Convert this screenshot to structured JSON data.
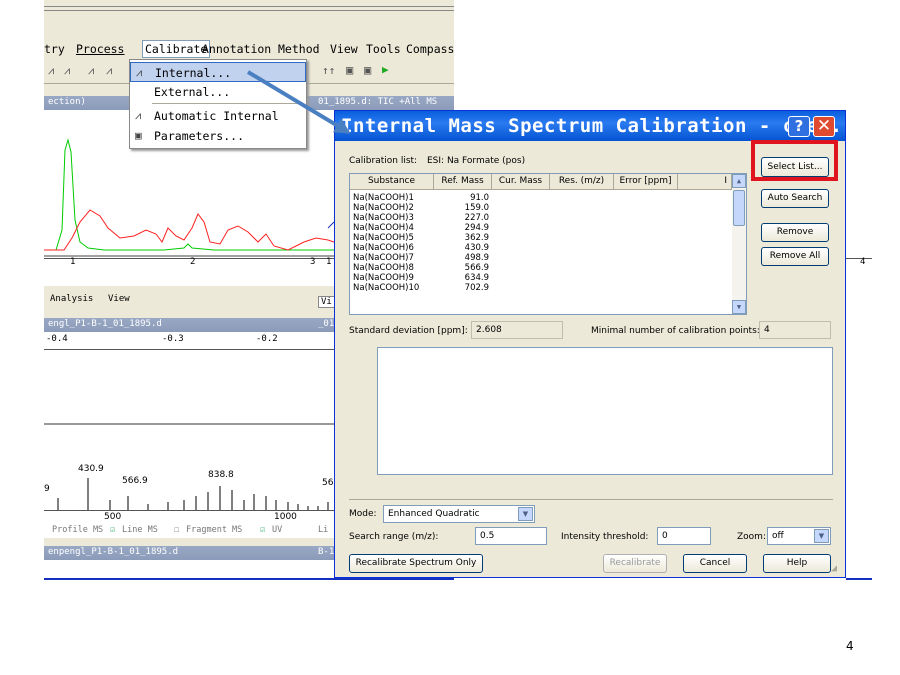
{
  "menubar": {
    "items": [
      "try",
      "Process",
      "Calibrate",
      "Annotation",
      "Method",
      "View",
      "Tools",
      "Compass"
    ],
    "active": "Calibrate"
  },
  "calibrate_menu": {
    "items": [
      {
        "label": "Internal...",
        "icon": "internal-calib-icon",
        "highlighted": true
      },
      {
        "label": "External...",
        "icon": "",
        "highlighted": false
      },
      {
        "label": "Automatic Internal",
        "icon": "auto-internal-icon",
        "highlighted": false
      },
      {
        "label": "Parameters...",
        "icon": "parameters-icon",
        "highlighted": false
      }
    ]
  },
  "background_app": {
    "chrom_title_left": "ection)",
    "chrom_title_right": "01_1895.d: TIC +All MS",
    "chrom_ticks": [
      "1",
      "2",
      "3",
      "1",
      "4"
    ],
    "tabs": [
      "Analysis",
      "View",
      "Vi"
    ],
    "spectrum_title": "engl_P1-B-1_01_1895.d",
    "spectrum_title_right": "_01",
    "spectrum_top_ticks": [
      "-0.4",
      "-0.3",
      "-0.2"
    ],
    "peak_labels": [
      "430.9",
      "566.9",
      "838.8",
      "9",
      "56"
    ],
    "spectrum_bottom_ticks": [
      "500",
      "1000"
    ],
    "spectrum_options": [
      "Profile MS",
      "Line MS",
      "Fragment MS",
      "UV",
      "Li"
    ],
    "spectrum2_title": "enpengl_P1-B-1_01_1895.d",
    "spectrum2_title_right": "B-1"
  },
  "dialog": {
    "title": "Internal Mass Spectrum Calibration - che...",
    "calibration_list_label": "Calibration list:",
    "calibration_list_value": "ESI: Na Formate (pos)",
    "columns": [
      "Substance",
      "Ref. Mass",
      "Cur. Mass",
      "Res. (m/z)",
      "Error [ppm]",
      "I"
    ],
    "rows": [
      {
        "substance": "Na(NaCOOH)1",
        "ref_mass": "91.0"
      },
      {
        "substance": "Na(NaCOOH)2",
        "ref_mass": "159.0"
      },
      {
        "substance": "Na(NaCOOH)3",
        "ref_mass": "227.0"
      },
      {
        "substance": "Na(NaCOOH)4",
        "ref_mass": "294.9"
      },
      {
        "substance": "Na(NaCOOH)5",
        "ref_mass": "362.9"
      },
      {
        "substance": "Na(NaCOOH)6",
        "ref_mass": "430.9"
      },
      {
        "substance": "Na(NaCOOH)7",
        "ref_mass": "498.9"
      },
      {
        "substance": "Na(NaCOOH)8",
        "ref_mass": "566.9"
      },
      {
        "substance": "Na(NaCOOH)9",
        "ref_mass": "634.9"
      },
      {
        "substance": "Na(NaCOOH)10",
        "ref_mass": "702.9"
      }
    ],
    "buttons": {
      "select_list": "Select List...",
      "auto_search": "Auto Search",
      "remove": "Remove",
      "remove_all": "Remove All",
      "recalibrate_spectrum_only": "Recalibrate Spectrum Only",
      "recalibrate": "Recalibrate",
      "cancel": "Cancel",
      "help": "Help"
    },
    "std_dev_label": "Standard deviation [ppm]:",
    "std_dev_value": "2.608",
    "min_points_label": "Minimal number of calibration points:",
    "min_points_value": "4",
    "mode_label": "Mode:",
    "mode_value": "Enhanced Quadratic",
    "search_range_label": "Search range (m/z):",
    "search_range_value": "0.5",
    "intensity_label": "Intensity threshold:",
    "intensity_value": "0",
    "zoom_label": "Zoom:",
    "zoom_value": "off"
  },
  "slide_number": "4",
  "colors": {
    "highlight_box": "#e0141e",
    "arrow": "#4a7fc1",
    "title_bar": "#0a5fdd",
    "chrom_red": "#ff2020",
    "chrom_green": "#00cc00"
  }
}
